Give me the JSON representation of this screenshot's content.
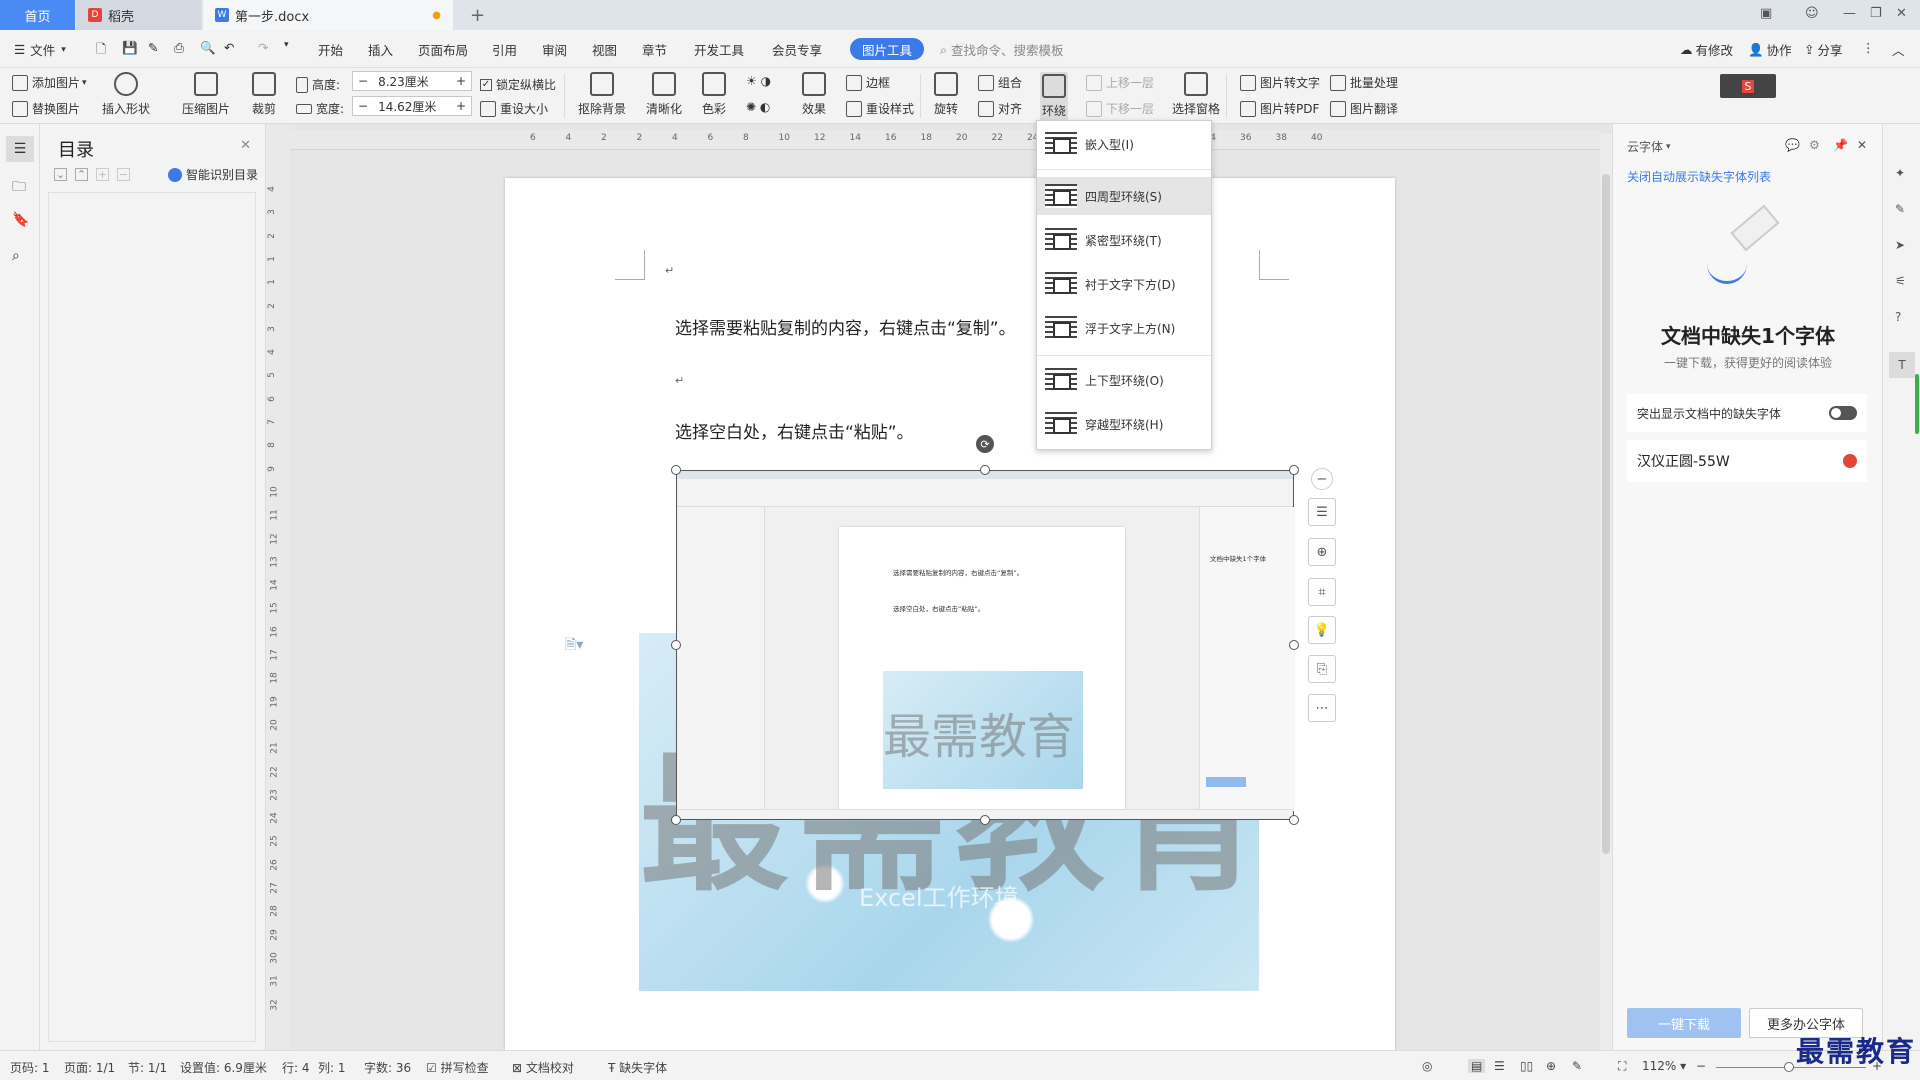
{
  "tabs": {
    "home": "首页",
    "daoke": "稻壳",
    "doc": "第一步.docx",
    "new_tab": "+"
  },
  "menu": {
    "file": "文件",
    "items": [
      "开始",
      "插入",
      "页面布局",
      "引用",
      "审阅",
      "视图",
      "章节",
      "开发工具",
      "会员专享"
    ],
    "pic_tools": "图片工具",
    "search": "查找命令、搜索模板",
    "has_changes": "有修改",
    "collab": "协作",
    "share": "分享"
  },
  "ribbon": {
    "add_pic": "添加图片",
    "replace_pic": "替换图片",
    "insert_shape": "插入形状",
    "compress": "压缩图片",
    "crop": "裁剪",
    "height_label": "高度:",
    "height_val": "8.23厘米",
    "width_label": "宽度:",
    "width_val": "14.62厘米",
    "lock_ratio": "锁定纵横比",
    "reset_size": "重设大小",
    "remove_bg": "抠除背景",
    "sharpen": "清晰化",
    "color": "色彩",
    "effect": "效果",
    "border": "边框",
    "reset_style": "重设样式",
    "rotate": "旋转",
    "group": "组合",
    "align": "对齐",
    "wrap": "环绕",
    "bring_up": "上移一层",
    "send_down": "下移一层",
    "select_pane": "选择窗格",
    "pic_to_text": "图片转文字",
    "batch": "批量处理",
    "pic_to_pdf": "图片转PDF",
    "pic_translate": "图片翻译"
  },
  "wrap_menu": [
    "嵌入型(I)",
    "四周型环绕(S)",
    "紧密型环绕(T)",
    "衬于文字下方(D)",
    "浮于文字上方(N)",
    "上下型环绕(O)",
    "穿越型环绕(H)"
  ],
  "toc": {
    "title": "目录",
    "smart": "智能识别目录"
  },
  "ruler": {
    "h_ticks": [
      "6",
      "4",
      "2",
      "2",
      "4",
      "6",
      "8",
      "10",
      "12",
      "14",
      "16",
      "18",
      "20",
      "22",
      "24",
      "26",
      "28",
      "30",
      "32",
      "34",
      "36",
      "38",
      "40"
    ],
    "v_ticks": [
      "4",
      "3",
      "2",
      "1",
      "1",
      "2",
      "3",
      "4",
      "5",
      "6",
      "7",
      "8",
      "9",
      "10",
      "11",
      "12",
      "13",
      "14",
      "15",
      "16",
      "17",
      "18",
      "19",
      "20",
      "21",
      "22",
      "23",
      "24",
      "25",
      "26",
      "27",
      "28",
      "29",
      "30",
      "31",
      "32"
    ]
  },
  "document": {
    "line1": "选择需要粘贴复制的内容，右键点击“复制”。",
    "line2": "选择空白处，右键点击“粘贴”。",
    "para_mark": "↵",
    "watermark_big": "最需教育",
    "watermark_sub": "Excel工作环境"
  },
  "embed": {
    "title": "文档中缺失1个字体",
    "watermark": "最需教育",
    "line1": "选择需要粘贴复制的内容，右键点击“复制”。",
    "line2": "选择空白处，右键点击“粘贴”。"
  },
  "right_panel": {
    "header": "云字体",
    "link": "关闭自动展示缺失字体列表",
    "title": "文档中缺失1个字体",
    "subtitle": "一键下载，获得更好的阅读体验",
    "toggle_label": "突出显示文档中的缺失字体",
    "font_name": "汉仪正圆-55W",
    "download_btn": "一键下载",
    "more_btn": "更多办公字体"
  },
  "status": {
    "page_num": "页码: 1",
    "pages": "页面: 1/1",
    "section": "节: 1/1",
    "setting": "设置值: 6.9厘米",
    "row": "行: 4",
    "col": "列: 1",
    "words": "字数: 36",
    "spell": "拼写检查",
    "proof": "文档校对",
    "missing_font": "缺失字体",
    "zoom": "112%"
  },
  "brand": "最需教育",
  "colors": {
    "accent": "#3b7ae8",
    "home_tab": "#4a8af4",
    "wps_red": "#e2463b"
  }
}
